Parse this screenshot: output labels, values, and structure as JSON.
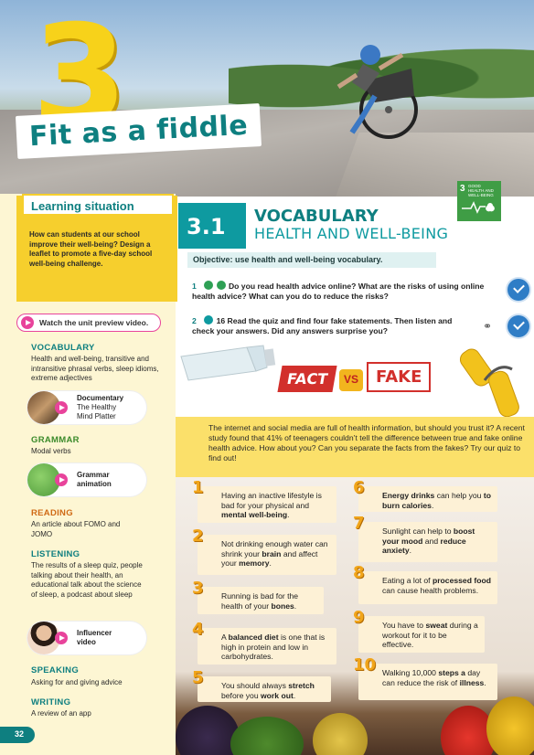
{
  "hero": {
    "unit_number": "3",
    "unit_title": "Fit as a fiddle",
    "sdg_number": "3",
    "sdg_label": "GOOD HEALTH AND WELL-BEING"
  },
  "sidebar": {
    "learning_situation": {
      "title": "Learning situation",
      "text": "How can students at our school improve their well-being? Design a leaflet to promote a five-day school well-being challenge."
    },
    "preview_label": "Watch the unit preview video.",
    "vocabulary": {
      "heading": "VOCABULARY",
      "text": "Health and well-being, transitive and intransitive phrasal verbs, sleep idioms, extreme adjectives"
    },
    "documentary": {
      "line1": "Documentary",
      "line2": "The Healthy",
      "line3": "Mind Platter"
    },
    "grammar": {
      "heading": "GRAMMAR",
      "text": "Modal verbs"
    },
    "grammar_animation": {
      "line1": "Grammar",
      "line2": "animation"
    },
    "reading": {
      "heading": "READING",
      "text": "An article about FOMO and JOMO"
    },
    "listening": {
      "heading": "LISTENING",
      "text": "The results of a sleep quiz, people talking about their health, an educational talk about the science of sleep, a podcast about sleep"
    },
    "influencer": {
      "line1": "Influencer",
      "line2": "video"
    },
    "speaking": {
      "heading": "SPEAKING",
      "text": "Asking for and giving advice"
    },
    "writing": {
      "heading": "WRITING",
      "text": "A review of an app"
    },
    "page_number": "32"
  },
  "main": {
    "section_number": "3.1",
    "section_title": "VOCABULARY",
    "section_subtitle": "HEALTH AND WELL-BEING",
    "objective": "Objective: use health and well-being vocabulary.",
    "q1": {
      "num": "1",
      "text": "Do you read health advice online? What are the risks of using online health advice? What can you do to reduce the risks?"
    },
    "q2": {
      "num": "2",
      "track": "16",
      "text": "Read the quiz and find four fake statements. Then listen and check your answers. Did any answers surprise you?"
    },
    "fact_label": "FACT",
    "vs_label": "VS",
    "fake_label": "FAKE",
    "intro": "The internet and social media are full of health information, but should you trust it? A recent study found that 41% of teenagers couldn’t tell the difference between true and fake online health advice. How about you? Can you separate the facts from the fakes? Try our quiz to find out!",
    "quiz": [
      {
        "n": "1",
        "parts": [
          "Having an inactive lifestyle is bad for your physical and ",
          "mental well-being",
          "."
        ]
      },
      {
        "n": "2",
        "parts": [
          "Not drinking enough water can shrink your ",
          "brain",
          " and affect your ",
          "memory",
          "."
        ]
      },
      {
        "n": "3",
        "parts": [
          "Running is bad for the health of your ",
          "bones",
          "."
        ]
      },
      {
        "n": "4",
        "parts": [
          "A ",
          "balanced diet",
          " is one that is high in protein and low in carbohydrates."
        ]
      },
      {
        "n": "5",
        "parts": [
          "You should always ",
          "stretch",
          " before you ",
          "work out",
          "."
        ]
      },
      {
        "n": "6",
        "parts": [
          "",
          "Energy drinks",
          " can help you ",
          "to burn calories",
          "."
        ]
      },
      {
        "n": "7",
        "parts": [
          "Sunlight can help to ",
          "boost your mood",
          " and ",
          "reduce anxiety",
          "."
        ]
      },
      {
        "n": "8",
        "parts": [
          "Eating a lot of ",
          "processed food",
          " can cause health problems."
        ]
      },
      {
        "n": "9",
        "parts": [
          "You have to ",
          "sweat",
          " during a workout for it to be effective."
        ]
      },
      {
        "n": "10",
        "parts": [
          "Walking 10,000 ",
          "steps a",
          " day can reduce the risk of ",
          "illness",
          "."
        ]
      }
    ]
  }
}
